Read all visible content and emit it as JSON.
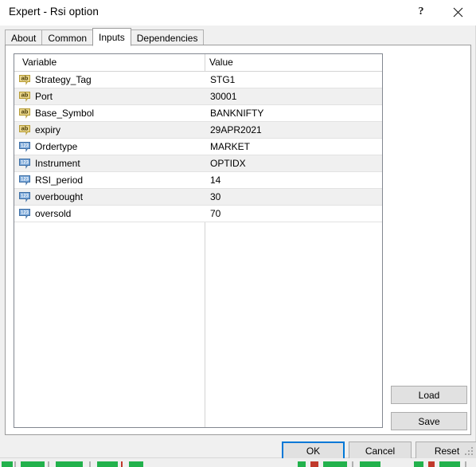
{
  "window": {
    "title": "Expert - Rsi option",
    "help_icon": "question-mark-icon",
    "help_label": "?",
    "close_icon": "close-icon",
    "close_label": "✕"
  },
  "tabs": [
    {
      "label": "About",
      "active": false
    },
    {
      "label": "Common",
      "active": false
    },
    {
      "label": "Inputs",
      "active": true
    },
    {
      "label": "Dependencies",
      "active": false
    }
  ],
  "grid": {
    "columns": [
      "Variable",
      "Value"
    ],
    "rows": [
      {
        "icon": "string-type-icon",
        "icon_label": "ab",
        "icon_kind": "string",
        "variable": "Strategy_Tag",
        "value": "STG1"
      },
      {
        "icon": "string-type-icon",
        "icon_label": "ab",
        "icon_kind": "string",
        "variable": "Port",
        "value": "30001"
      },
      {
        "icon": "string-type-icon",
        "icon_label": "ab",
        "icon_kind": "string",
        "variable": "Base_Symbol",
        "value": "BANKNIFTY"
      },
      {
        "icon": "string-type-icon",
        "icon_label": "ab",
        "icon_kind": "string",
        "variable": "expiry",
        "value": "29APR2021"
      },
      {
        "icon": "number-type-icon",
        "icon_label": "123",
        "icon_kind": "number",
        "variable": "Ordertype",
        "value": "MARKET"
      },
      {
        "icon": "number-type-icon",
        "icon_label": "123",
        "icon_kind": "number",
        "variable": "Instrument",
        "value": "OPTIDX"
      },
      {
        "icon": "number-type-icon",
        "icon_label": "123",
        "icon_kind": "number",
        "variable": "RSI_period",
        "value": "14"
      },
      {
        "icon": "number-type-icon",
        "icon_label": "123",
        "icon_kind": "number",
        "variable": "overbought",
        "value": "30"
      },
      {
        "icon": "number-type-icon",
        "icon_label": "123",
        "icon_kind": "number",
        "variable": "oversold",
        "value": "70"
      }
    ]
  },
  "side_buttons": {
    "load_label": "Load",
    "save_label": "Save"
  },
  "footer_buttons": {
    "ok_label": "OK",
    "cancel_label": "Cancel",
    "reset_label": "Reset"
  },
  "colors": {
    "dialog_background": "#f0f0f0",
    "panel_background": "#ffffff",
    "accent_focus": "#0078d7",
    "button_face": "#e1e1e1",
    "button_border": "#adadad",
    "row_alt_background": "#f0f0f0",
    "grid_border": "#828790",
    "string_icon": "#e8d48a",
    "number_icon": "#7aa7d8"
  }
}
